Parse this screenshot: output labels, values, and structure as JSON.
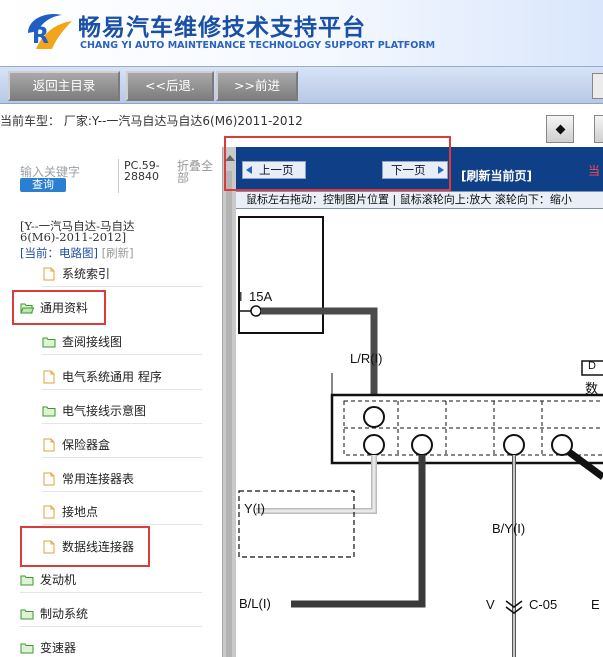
{
  "header": {
    "title_cn": "畅易汽车维修技术支持平台",
    "title_en": "CHANG YI AUTO MAINTENANCE TECHNOLOGY SUPPORT PLATFORM"
  },
  "toolbar": {
    "home_label": "返回主目录",
    "back_label": "<<后退.",
    "forward_label": ">>前进"
  },
  "model_bar": {
    "text": "当前车型：  厂家:Y--一汽马自达马自达6(M6)2011-2012"
  },
  "left_panel": {
    "keyword_placeholder": "输入关键字",
    "query_label": "查询",
    "pc_text": "PC.59-28840",
    "fold_text": "折叠全部",
    "current_vehicle": "[Y--一汽马自达-马自达6(M6)-2011-2012]",
    "current_label": "[当前：电路图]",
    "refresh_label": "[刷新]",
    "tree": [
      {
        "label": "系统索引",
        "icon": "page-icon"
      },
      {
        "label": "通用资料",
        "icon": "folder-open-icon"
      },
      {
        "label": "查阅接线图",
        "icon": "folder-icon"
      },
      {
        "label": "电气系统通用 程序",
        "icon": "page-icon"
      },
      {
        "label": "电气接线示意图",
        "icon": "folder-icon"
      },
      {
        "label": "保险器盒",
        "icon": "page-icon"
      },
      {
        "label": "常用连接器表",
        "icon": "page-icon"
      },
      {
        "label": "接地点",
        "icon": "page-icon"
      },
      {
        "label": "数据线连接器",
        "icon": "page-icon"
      },
      {
        "label": "发动机",
        "icon": "folder-icon"
      },
      {
        "label": "制动系统",
        "icon": "folder-icon"
      },
      {
        "label": "变速器",
        "icon": "folder-icon"
      }
    ]
  },
  "viewer": {
    "prev_label": "上一页",
    "next_label": "下一页",
    "refresh_label": "[刷新当前页]",
    "cut_text": "当",
    "hint": "鼠标左右拖动：控制图片位置 | 鼠标滚轮向上:放大   滚轮向下：缩小"
  },
  "diagram_labels": {
    "fuse": "15A",
    "wire_lr": "L/R(I)",
    "wire_y": "Y(I)",
    "wire_by": "B/Y(I)",
    "wire_bl": "B/L(I)",
    "conn_c05": "C-05",
    "v_mark": "V",
    "d_mark": "D",
    "num_mark": "数",
    "fuse_prefix": "I",
    "e_mark": "E"
  },
  "colors": {
    "brand_blue": "#1a4fa6",
    "viewer_header": "#0f3f87",
    "query_button": "#2c7fd0",
    "highlight_red": "#dc3b3b",
    "wire_gray": "#4a4a4a"
  }
}
